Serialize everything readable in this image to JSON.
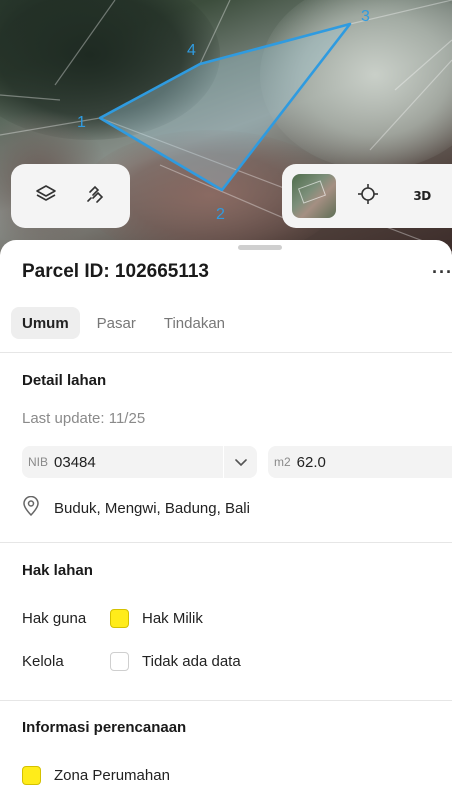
{
  "map": {
    "vertex_labels": [
      "1",
      "2",
      "3",
      "4"
    ],
    "parcel_color": "#2f9be0",
    "controls_left": [
      {
        "icon": "layers-icon"
      },
      {
        "icon": "draw-shape-icon"
      }
    ],
    "controls_right": [
      {
        "icon": "satellite-thumbnail"
      },
      {
        "icon": "crosshair-icon"
      },
      {
        "label": "3D"
      }
    ]
  },
  "sheet": {
    "title": "Parcel ID: 102665113",
    "more_label": "···",
    "tabs": [
      {
        "label": "Umum",
        "active": true
      },
      {
        "label": "Pasar",
        "active": false
      },
      {
        "label": "Tindakan",
        "active": false
      }
    ],
    "detail": {
      "heading": "Detail lahan",
      "last_update": "Last update: 11/25",
      "nib_prefix": "NIB",
      "nib_value": "03484",
      "area_prefix": "m2",
      "area_value": "62.0",
      "location": "Buduk, Mengwi, Badung, Bali"
    },
    "rights": {
      "heading": "Hak lahan",
      "rows": [
        {
          "key": "Hak guna",
          "value": "Hak Milik",
          "swatch": "#ffec1a"
        },
        {
          "key": "Kelola",
          "value": "Tidak ada data",
          "swatch": "#ffffff"
        }
      ]
    },
    "planning": {
      "heading": "Informasi perencanaan",
      "zone_label": "Zona Perumahan",
      "zone_color": "#ffec1a"
    }
  }
}
